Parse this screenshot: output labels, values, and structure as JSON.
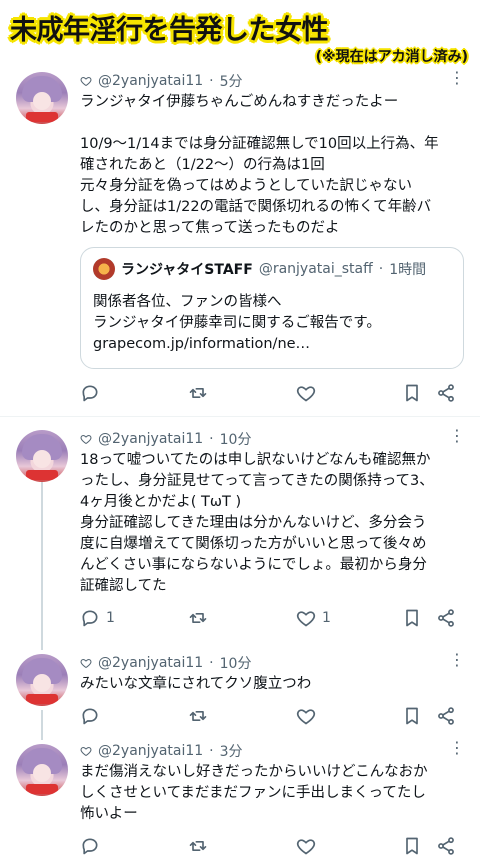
{
  "banner": {
    "title": "未成年淫行を告発した女性",
    "subtitle": "(※現在はアカ消し済み)"
  },
  "tweets": [
    {
      "handle": "@2yanjyatai11",
      "time": "5分",
      "lines": [
        "ランジャタイ伊藤ちゃんごめんねすきだったよー",
        "",
        "10/9〜1/14までは身分証確認無しで10回以上行為、年",
        "確されたあと（1/22〜）の行為は1回",
        "元々身分証を偽ってはめようとしていた訳じゃない",
        "し、身分証は1/22の電話で関係切れるの怖くて年齢バ",
        "レたのかと思って焦って送ったものだよ"
      ],
      "quote": {
        "name": "ランジャタイSTAFF",
        "handle": "@ranjyatai_staff",
        "time": "1時間",
        "lines": [
          "関係者各位、ファンの皆様へ",
          "ランジャタイ伊藤幸司に関するご報告です。",
          "grapecom.jp/information/ne…"
        ]
      },
      "reply_count": "",
      "like_count": ""
    },
    {
      "handle": "@2yanjyatai11",
      "time": "10分",
      "lines": [
        "18って嘘ついてたのは申し訳ないけどなんも確認無か",
        "ったし、身分証見せてって言ってきたの関係持って3、",
        "4ヶ月後とかだよ( TωT )",
        "身分証確認してきた理由は分かんないけど、多分会う",
        "度に自爆増えてて関係切った方がいいと思って後々め",
        "んどくさい事にならないようにでしょ。最初から身分",
        "証確認してた"
      ],
      "reply_count": "1",
      "like_count": "1"
    },
    {
      "handle": "@2yanjyatai11",
      "time": "10分",
      "lines": [
        "みたいな文章にされてクソ腹立つわ"
      ],
      "reply_count": "",
      "like_count": ""
    },
    {
      "handle": "@2yanjyatai11",
      "time": "3分",
      "lines": [
        "まだ傷消えないし好きだったからいいけどこんなおか",
        "しくさせといてまだまだファンに手出しまくってたし",
        "怖いよー"
      ],
      "reply_count": "",
      "like_count": ""
    }
  ],
  "icons": {
    "header_like": "heart-outline-icon",
    "more": "more-dots-icon",
    "reply": "reply-bubble-icon",
    "retweet": "retweet-icon",
    "like": "heart-outline-icon",
    "bookmark": "bookmark-icon",
    "share": "share-icon"
  },
  "colors": {
    "banner_highlight": "#f6e400",
    "muted_text": "#536471",
    "main_text": "#0f1419",
    "border": "#cfd9de"
  }
}
